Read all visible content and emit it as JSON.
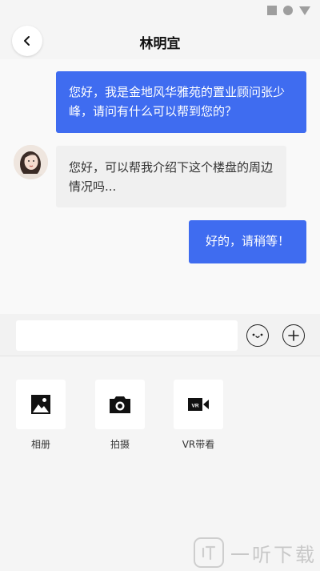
{
  "header": {
    "title": "林明宜"
  },
  "messages": [
    {
      "side": "outgoing",
      "text": "您好，我是金地风华雅苑的置业顾问张少峰，请问有什么可以帮到您的？"
    },
    {
      "side": "incoming",
      "text": "您好，可以帮我介绍下这个楼盘的周边情况吗..."
    },
    {
      "side": "outgoing",
      "text": "好的，请稍等！"
    }
  ],
  "input": {
    "placeholder": ""
  },
  "tools": [
    {
      "label": "相册",
      "icon": "image-icon"
    },
    {
      "label": "拍摄",
      "icon": "camera-icon"
    },
    {
      "label": "VR带看",
      "icon": "vr-camera-icon"
    }
  ],
  "watermark": {
    "text": "一听下载"
  },
  "colors": {
    "accent": "#3f6cf0",
    "incoming_bubble": "#f0f0f0",
    "background": "#f5f5f5"
  }
}
